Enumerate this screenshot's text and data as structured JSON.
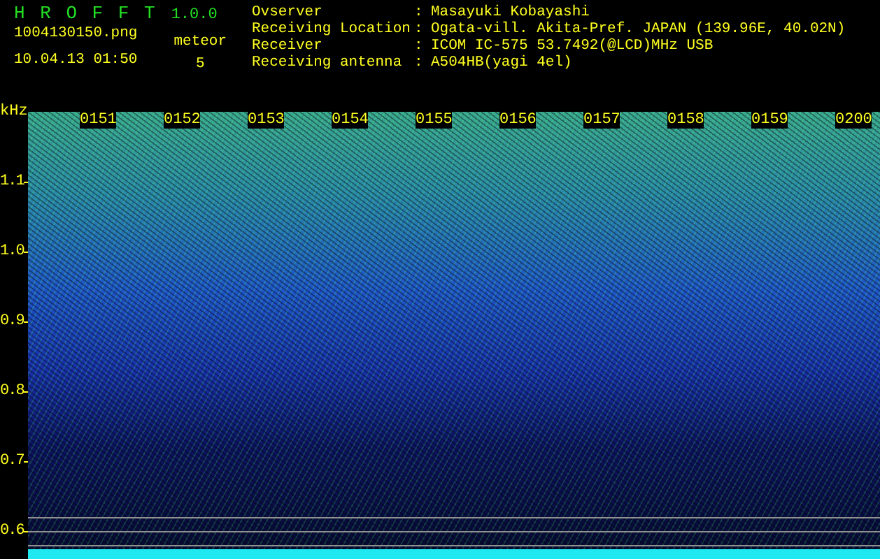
{
  "app": {
    "name": "H R O F F T",
    "version": "1.0.0"
  },
  "file": "1004130150.png",
  "datetime": "10.04.13 01:50",
  "meteor": {
    "label": "meteor",
    "count": "5"
  },
  "info": [
    {
      "label": "Ovserver",
      "separator": ":",
      "value": "Masayuki Kobayashi"
    },
    {
      "label": "Receiving Location",
      "separator": ":",
      "value": "Ogata-vill. Akita-Pref. JAPAN (139.96E, 40.02N)"
    },
    {
      "label": "Receiver",
      "separator": ":",
      "value": "ICOM IC-575 53.7492(@LCD)MHz USB"
    },
    {
      "label": "Receiving antenna",
      "separator": ":",
      "value": "A504HB(yagi 4el)"
    }
  ],
  "spectrogram": {
    "unit": "kHz",
    "frequency_labels": [
      "1.1",
      "1.0",
      "0.9",
      "0.8",
      "0.7",
      "0.6"
    ],
    "time_labels": [
      "0151",
      "0152",
      "0153",
      "0154",
      "0155",
      "0156",
      "0157",
      "0158",
      "0159",
      "0200"
    ]
  }
}
